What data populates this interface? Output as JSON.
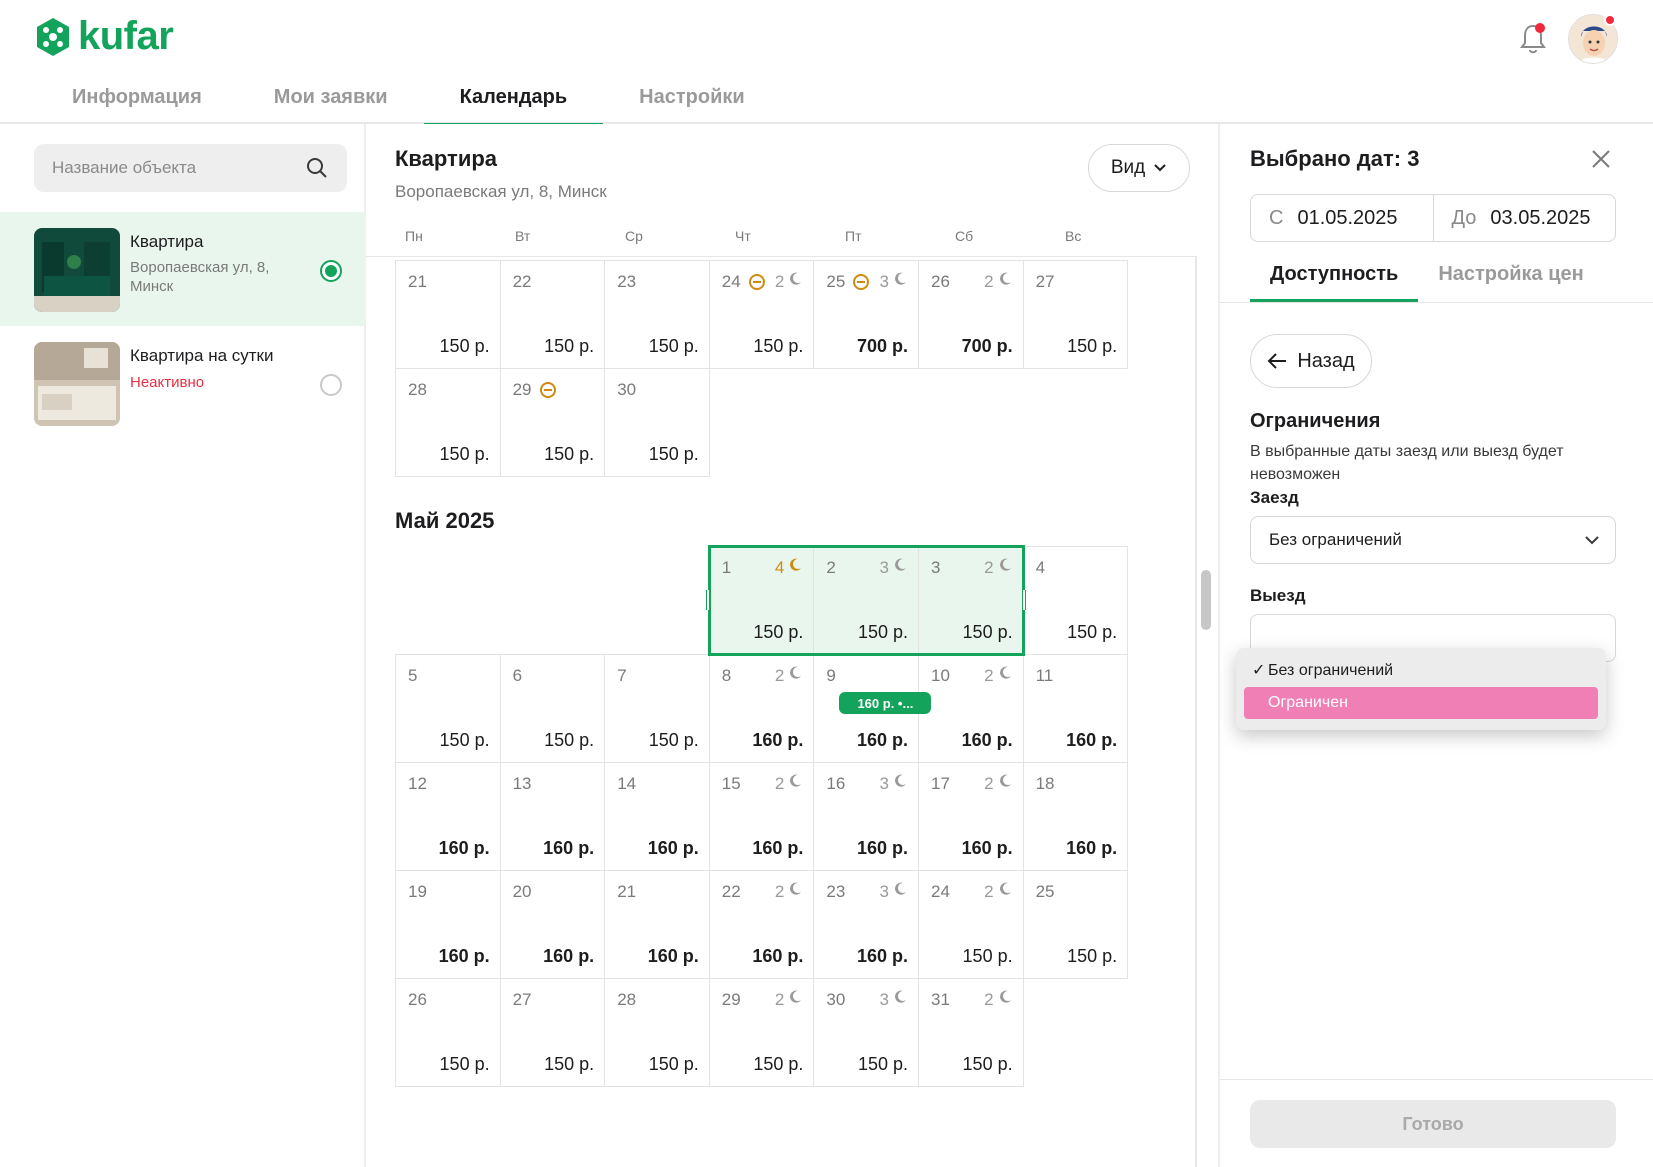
{
  "brand": {
    "name": "kufar",
    "color": "#14a35b"
  },
  "nav": {
    "tabs": [
      "Информация",
      "Мои заявки",
      "Календарь",
      "Настройки"
    ],
    "active": "Календарь"
  },
  "header": {
    "bell_icon": "bell-icon",
    "avatar_icon": "user-avatar"
  },
  "sidebar": {
    "search_placeholder": "Название объекта",
    "objects": [
      {
        "title": "Квартира",
        "address": "Воропаевская ул, 8, Минск",
        "selected": true
      },
      {
        "title": "Квартира на сутки",
        "status": "Неактивно",
        "selected": false
      }
    ]
  },
  "calendar": {
    "title": "Квартира",
    "address": "Воропаевская ул, 8, Минск",
    "view_label": "Вид",
    "weekdays": [
      "Пн",
      "Вт",
      "Ср",
      "Чт",
      "Пт",
      "Сб",
      "Вс"
    ],
    "april_rows": [
      [
        {
          "d": "21",
          "p": "150 р."
        },
        {
          "d": "22",
          "p": "150 р."
        },
        {
          "d": "23",
          "p": "150 р."
        },
        {
          "d": "24",
          "p": "150 р.",
          "block": true,
          "nights": "2"
        },
        {
          "d": "25",
          "p": "700 р.",
          "bold": true,
          "block": true,
          "nights": "3"
        },
        {
          "d": "26",
          "p": "700 р.",
          "bold": true,
          "nights": "2"
        },
        {
          "d": "27",
          "p": "150 р."
        }
      ],
      [
        {
          "d": "28",
          "p": "150 р."
        },
        {
          "d": "29",
          "p": "150 р.",
          "block": true
        },
        {
          "d": "30",
          "p": "150 р."
        }
      ]
    ],
    "month_label": "Май 2025",
    "may_rows": [
      [
        {
          "col": 3,
          "d": "1",
          "p": "150 р.",
          "nights": "4",
          "nights_accent": true,
          "sel": true
        },
        {
          "col": 4,
          "d": "2",
          "p": "150 р.",
          "nights": "3",
          "sel": true
        },
        {
          "col": 5,
          "d": "3",
          "p": "150 р.",
          "nights": "2",
          "sel": true
        },
        {
          "col": 6,
          "d": "4",
          "p": "150 р."
        }
      ],
      [
        {
          "col": 0,
          "d": "5",
          "p": "150 р."
        },
        {
          "col": 1,
          "d": "6",
          "p": "150 р."
        },
        {
          "col": 2,
          "d": "7",
          "p": "150 р."
        },
        {
          "col": 3,
          "d": "8",
          "p": "160 р.",
          "bold": true,
          "nights": "2"
        },
        {
          "col": 4,
          "d": "9",
          "p": "160 р.",
          "bold": true,
          "tag": "160 р. •..."
        },
        {
          "col": 5,
          "d": "10",
          "p": "160 р.",
          "bold": true,
          "nights": "2"
        },
        {
          "col": 6,
          "d": "11",
          "p": "160 р.",
          "bold": true
        }
      ],
      [
        {
          "col": 0,
          "d": "12",
          "p": "160 р.",
          "bold": true
        },
        {
          "col": 1,
          "d": "13",
          "p": "160 р.",
          "bold": true
        },
        {
          "col": 2,
          "d": "14",
          "p": "160 р.",
          "bold": true
        },
        {
          "col": 3,
          "d": "15",
          "p": "160 р.",
          "bold": true,
          "nights": "2"
        },
        {
          "col": 4,
          "d": "16",
          "p": "160 р.",
          "bold": true,
          "nights": "3"
        },
        {
          "col": 5,
          "d": "17",
          "p": "160 р.",
          "bold": true,
          "nights": "2"
        },
        {
          "col": 6,
          "d": "18",
          "p": "160 р.",
          "bold": true
        }
      ],
      [
        {
          "col": 0,
          "d": "19",
          "p": "160 р.",
          "bold": true
        },
        {
          "col": 1,
          "d": "20",
          "p": "160 р.",
          "bold": true
        },
        {
          "col": 2,
          "d": "21",
          "p": "160 р.",
          "bold": true
        },
        {
          "col": 3,
          "d": "22",
          "p": "160 р.",
          "bold": true,
          "nights": "2"
        },
        {
          "col": 4,
          "d": "23",
          "p": "160 р.",
          "bold": true,
          "nights": "3"
        },
        {
          "col": 5,
          "d": "24",
          "p": "150 р.",
          "nights": "2"
        },
        {
          "col": 6,
          "d": "25",
          "p": "150 р."
        }
      ],
      [
        {
          "col": 0,
          "d": "26",
          "p": "150 р."
        },
        {
          "col": 1,
          "d": "27",
          "p": "150 р."
        },
        {
          "col": 2,
          "d": "28",
          "p": "150 р."
        },
        {
          "col": 3,
          "d": "29",
          "p": "150 р.",
          "nights": "2"
        },
        {
          "col": 4,
          "d": "30",
          "p": "150 р.",
          "nights": "3"
        },
        {
          "col": 5,
          "d": "31",
          "p": "150 р.",
          "nights": "2"
        }
      ]
    ]
  },
  "panel": {
    "title": "Выбрано дат: 3",
    "from_prefix": "С",
    "from": "01.05.2025",
    "to_prefix": "До",
    "to": "03.05.2025",
    "tabs": [
      "Доступность",
      "Настройка цен"
    ],
    "back_label": "Назад",
    "section_title": "Ограничения",
    "section_desc": "В выбранные даты заезд или выезд будет невозможен",
    "checkin_label": "Заезд",
    "checkin_value": "Без ограничений",
    "checkout_label": "Выезд",
    "dropdown_options": [
      "Без ограничений",
      "Ограничен"
    ],
    "dropdown_checked": "Без ограничений",
    "dropdown_highlight": "Ограничен",
    "highlight_color": "#f07fb6",
    "done_label": "Готово"
  }
}
